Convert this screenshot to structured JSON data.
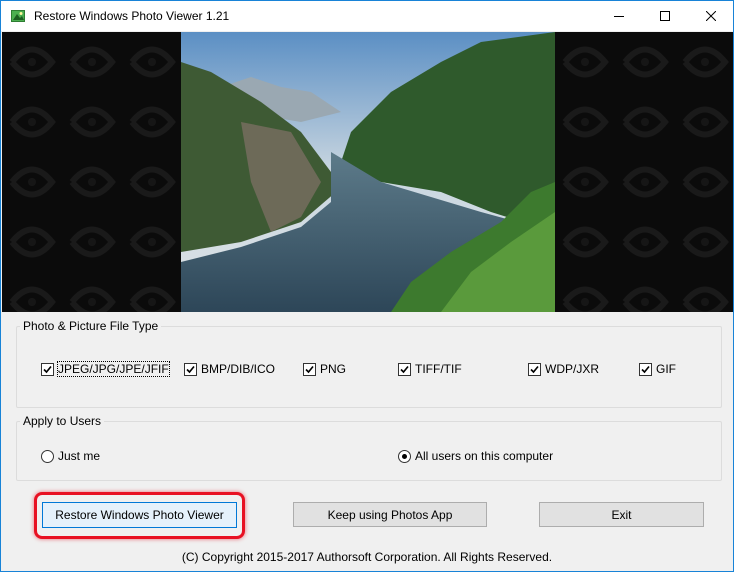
{
  "window": {
    "title": "Restore Windows Photo Viewer 1.21",
    "controls": {
      "minimize": "─",
      "maximize": "☐",
      "close": "✕"
    }
  },
  "file_types": {
    "group_label": "Photo & Picture File Type",
    "items": [
      {
        "label": "JPEG/JPG/JPE/JFIF",
        "checked": true
      },
      {
        "label": "BMP/DIB/ICO",
        "checked": true
      },
      {
        "label": "PNG",
        "checked": true
      },
      {
        "label": "TIFF/TIF",
        "checked": true
      },
      {
        "label": "WDP/JXR",
        "checked": true
      },
      {
        "label": "GIF",
        "checked": true
      }
    ]
  },
  "users": {
    "group_label": "Apply to Users",
    "options": [
      {
        "label": "Just me",
        "selected": false
      },
      {
        "label": "All users on this computer",
        "selected": true
      }
    ]
  },
  "buttons": {
    "restore": "Restore Windows Photo Viewer",
    "keep": "Keep using Photos App",
    "exit": "Exit"
  },
  "footer": {
    "copyright": "(C) Copyright 2015-2017 Authorsoft Corporation. All Rights Reserved."
  },
  "colors": {
    "accent": "#0078d7",
    "highlight": "#e81123",
    "window_border": "#1883d7"
  }
}
